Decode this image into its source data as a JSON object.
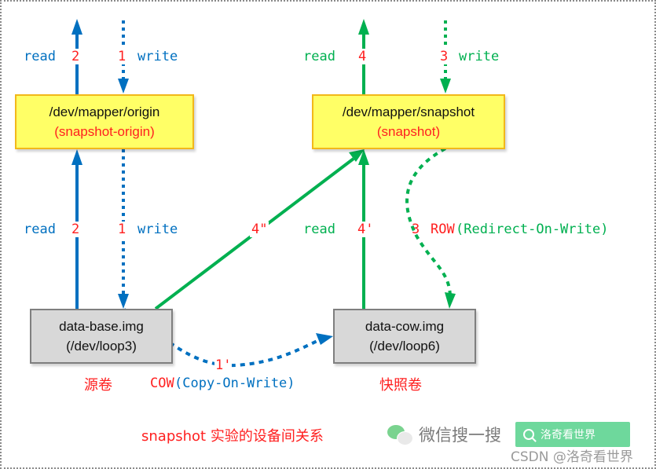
{
  "colors": {
    "origin_path": "#0070c0",
    "snapshot_path": "#00b050",
    "step_number": "#ff2020",
    "device_box_fill": "#ffff66",
    "device_box_border": "#f2b81a",
    "image_box_fill": "#d8d8d8"
  },
  "nodes": {
    "origin_device": {
      "title": "/dev/mapper/origin",
      "subtitle": "(snapshot-origin)"
    },
    "snapshot_device": {
      "title": "/dev/mapper/snapshot",
      "subtitle": "(snapshot)"
    },
    "base_image": {
      "title": "data-base.img",
      "subtitle": "(/dev/loop3)",
      "caption": "源卷"
    },
    "cow_image": {
      "title": "data-cow.img",
      "subtitle": "(/dev/loop6)",
      "caption": "快照卷"
    }
  },
  "edges": {
    "origin_top_read": {
      "label": "read",
      "step": "2"
    },
    "origin_top_write": {
      "label": "write",
      "step": "1"
    },
    "origin_bottom_read": {
      "label": "read",
      "step": "2"
    },
    "origin_bottom_write": {
      "label": "write",
      "step": "1"
    },
    "snapshot_top_read": {
      "label": "read",
      "step": "4"
    },
    "snapshot_top_write": {
      "label": "write",
      "step": "3"
    },
    "base_to_snapshot": {
      "step": "4\""
    },
    "cow_to_snapshot_read": {
      "label": "read",
      "step": "4'"
    },
    "snapshot_to_cow_row": {
      "step": "3",
      "abbr": "ROW",
      "full": "(Redirect-On-Write)"
    },
    "base_to_cow_cow": {
      "step": "1'",
      "abbr": "COW",
      "full": "(Copy-On-Write)"
    }
  },
  "caption": "snapshot 实验的设备间关系",
  "watermark": {
    "wechat_text": "微信搜一搜",
    "search_text": "洛奇看世界",
    "csdn_text": "CSDN @洛奇看世界"
  }
}
